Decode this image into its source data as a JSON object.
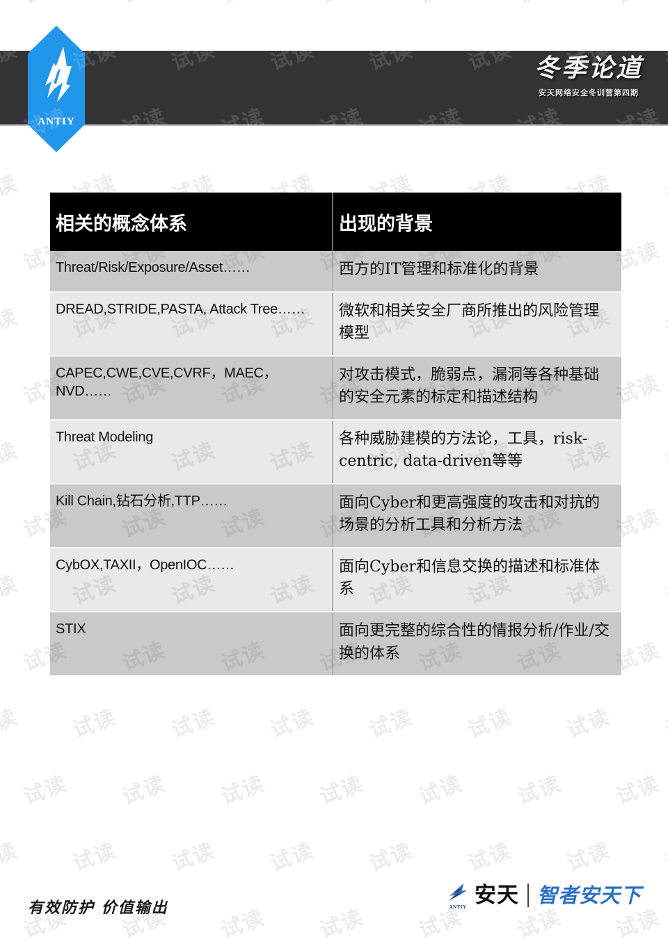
{
  "header": {
    "logo_brand": "ANTIY",
    "logo_icon": "antiy-wing-logo",
    "calligraphy_title": "冬季论道",
    "calligraphy_subtitle": "安天网络安全冬训营第四期"
  },
  "watermark": {
    "text": "试读"
  },
  "table": {
    "columns": [
      "相关的概念体系",
      "出现的背景"
    ],
    "rows": [
      {
        "term": "Threat/Risk/Exposure/Asset……",
        "background": "西方的IT管理和标准化的背景"
      },
      {
        "term": "DREAD,STRIDE,PASTA, Attack Tree……",
        "background": "微软和相关安全厂商所推出的风险管理模型"
      },
      {
        "term": "CAPEC,CWE,CVE,CVRF，MAEC，NVD……",
        "background": "对攻击模式，脆弱点，漏洞等各种基础的安全元素的标定和描述结构"
      },
      {
        "term": "Threat Modeling",
        "background": "各种威胁建模的方法论，工具，risk-centric, data-driven等等"
      },
      {
        "term": "Kill Chain,钻石分析,TTP……",
        "background": "面向Cyber和更高强度的攻击和对抗的场景的分析工具和分析方法"
      },
      {
        "term": "CybOX,TAXII，OpenIOC……",
        "background": "面向Cyber和信息交换的描述和标准体系"
      },
      {
        "term": "STIX",
        "background": "面向更完整的综合性的情报分析/作业/交换的体系"
      }
    ]
  },
  "footer": {
    "slogan": "有效防护 价值输出",
    "logo_mark": "antiy-wing-logo",
    "logo_sub": "ANTIY",
    "logo_name": "安天",
    "logo_tagline": "智者安天下"
  },
  "colors": {
    "brand_blue": "#2196ea",
    "header_bar": "#333336",
    "table_header": "#000000",
    "row_odd": "#c9c9c9",
    "row_even": "#e9e9e9",
    "tagline_blue": "#2a6fc4"
  }
}
